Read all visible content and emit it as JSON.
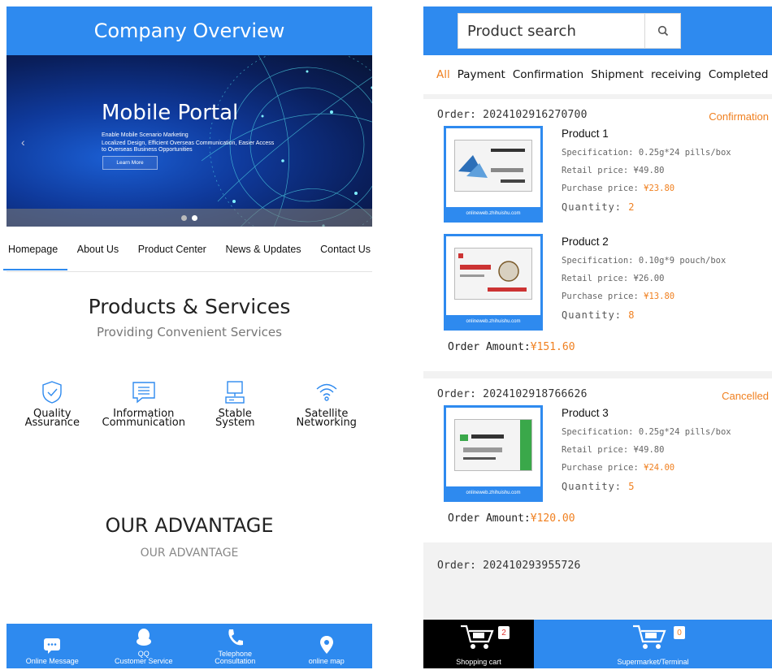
{
  "left": {
    "header_title": "Company Overview",
    "banner": {
      "title": "Mobile Portal",
      "line1": "Enable Mobile Scenario Marketing",
      "line2": "Localized Design, Efficient Overseas Communication, Easier Access to Overseas Business Opportunities",
      "button": "Learn More",
      "prev_arrow": "‹"
    },
    "nav": [
      "Homepage",
      "About Us",
      "Product Center",
      "News & Updates",
      "Contact Us"
    ],
    "section_title": "Products & Services",
    "section_subtitle": "Providing Convenient Services",
    "features": [
      {
        "label": "Quality\nAssurance",
        "icon": "shield-check-icon"
      },
      {
        "label": "Information\nCommunication",
        "icon": "message-list-icon"
      },
      {
        "label": "Stable\nSystem",
        "icon": "computer-icon"
      },
      {
        "label": "Satellite\nNetworking",
        "icon": "wifi-icon"
      }
    ],
    "advantage_title": "OUR ADVANTAGE",
    "advantage_subtitle": "OUR ADVANTAGE",
    "footer": [
      {
        "label": "Online Message",
        "icon": "chat-bubble-icon"
      },
      {
        "label": "QQ\nCustomer Service",
        "icon": "qq-penguin-icon"
      },
      {
        "label": "Telephone\nConsultation",
        "icon": "phone-icon"
      },
      {
        "label": "online map",
        "icon": "map-pin-icon"
      }
    ],
    "colors": {
      "primary": "#2e8aef"
    }
  },
  "right": {
    "search_placeholder": "Product search",
    "tabs": [
      "All",
      "Payment",
      "Confirmation",
      "Shipment",
      "receiving",
      "Completed"
    ],
    "orders": [
      {
        "order_no": "Order: 2024102916270700",
        "status": "Confirmation",
        "products": [
          {
            "name": "Product 1",
            "spec_label": "Specification: ",
            "spec": "0.25g*24 pills/box",
            "retail_label": "Retail price: ",
            "retail": "¥49.80",
            "purchase_label": "Purchase price: ",
            "purchase": "¥23.80",
            "qty_label": "Quantity: ",
            "qty": "2",
            "watermark": "onlineweb.zhihuishu.com"
          },
          {
            "name": "Product 2",
            "spec_label": "Specification: ",
            "spec": "0.10g*9 pouch/box",
            "retail_label": "Retail price: ",
            "retail": "¥26.00",
            "purchase_label": "Purchase price: ",
            "purchase": "¥13.80",
            "qty_label": "Quantity: ",
            "qty": "8",
            "watermark": "onlineweb.zhihuishu.com"
          }
        ],
        "amount_label": "Order Amount:",
        "amount": "¥151.60"
      },
      {
        "order_no": "Order: 2024102918766626",
        "status": "Cancelled",
        "products": [
          {
            "name": "Product 3",
            "spec_label": "Specification: ",
            "spec": "0.25g*24 pills/box",
            "retail_label": "Retail price: ",
            "retail": "¥49.80",
            "purchase_label": "Purchase price: ",
            "purchase": "¥24.00",
            "qty_label": "Quantity: ",
            "qty": "5",
            "watermark": "onlineweb.zhihuishu.com"
          }
        ],
        "amount_label": "Order Amount:",
        "amount": "¥120.00"
      },
      {
        "order_no": "Order: 202410293955726"
      }
    ],
    "footer": {
      "cart_label": "Shopping cart",
      "cart_badge": "2",
      "super_label": "Supermarket/Terminal",
      "super_badge": "0"
    },
    "colors": {
      "primary": "#2e8aef",
      "accent": "#f08020"
    }
  }
}
